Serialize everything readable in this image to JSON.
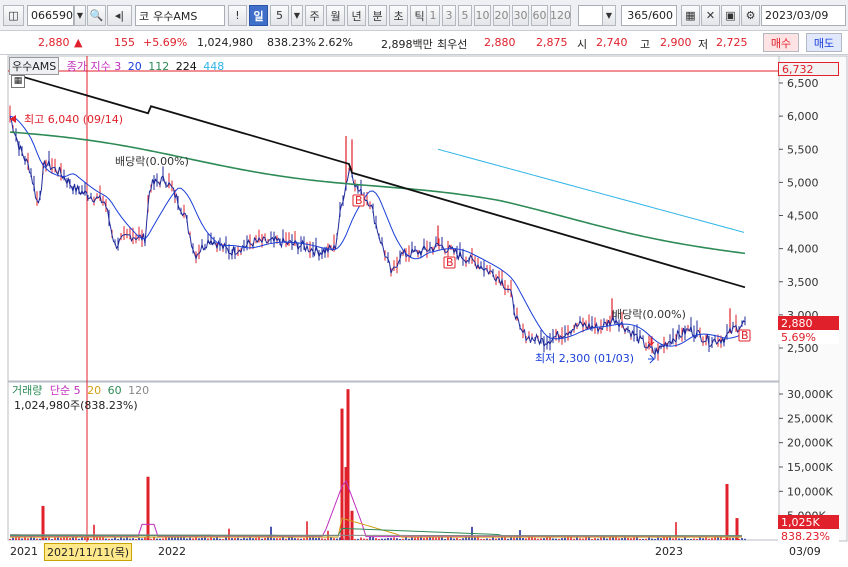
{
  "toolbar": {
    "stock_code": "066590",
    "market_code": "코",
    "stock_name": "우수AMS",
    "period_tabs": [
      {
        "label": "!",
        "active": false
      },
      {
        "label": "일",
        "active": true
      },
      {
        "label": "5",
        "active": false
      },
      {
        "label": "주",
        "active": false
      },
      {
        "label": "월",
        "active": false
      },
      {
        "label": "년",
        "active": false
      },
      {
        "label": "분",
        "active": false
      },
      {
        "label": "초",
        "active": false
      },
      {
        "label": "틱",
        "active": false
      }
    ],
    "minute_options": [
      "1",
      "3",
      "5",
      "10",
      "20",
      "30",
      "60",
      "120"
    ],
    "count_value": "365",
    "count_total": "/600",
    "date_value": "2023/03/09"
  },
  "quote": {
    "price": "2,880",
    "change_arrow": "▲",
    "change": "155",
    "change_pct": "+5.69%",
    "volume": "1,024,980",
    "volume_ratio": "838.23%",
    "turnover": "2.62%",
    "amount": "2,898백만",
    "priority_label": "최우선",
    "priority_ask": "2,880",
    "priority_bid": "2,875",
    "open_label": "시",
    "open": "2,740",
    "high_label": "고",
    "high": "2,900",
    "low_label": "저",
    "low": "2,725",
    "buy_label": "매수",
    "sell_label": "매도"
  },
  "price_panel": {
    "stock_name": "우수AMS",
    "ma_title": "종가 지수 3",
    "ma_periods": [
      "20",
      "112",
      "224",
      "448"
    ],
    "y_ticks": [
      "6,500",
      "6,000",
      "5,500",
      "5,000",
      "4,500",
      "4,000",
      "3,500",
      "3,000",
      "2,500"
    ],
    "high_tag": "6,732",
    "price_tag": "2,880",
    "pct_tag": "5.69%",
    "max_annotation": "최고 6,040 (09/14)",
    "min_annotation": "최저 2,300 (01/03)",
    "dividend_labels": [
      "배당락(0.00%)",
      "배당락(0.00%)"
    ],
    "marker_letter": "B",
    "colors": {
      "price_line": "#1f2a9a",
      "up_candle": "#e0202a",
      "ma20": "#1a3fd8",
      "ma112": "#2e8b57",
      "ma224": "#111111",
      "ma448": "#2fb4e8"
    }
  },
  "volume_panel": {
    "title": "거래량",
    "ma_label": "단순",
    "ma_periods": [
      "5",
      "20",
      "60",
      "120"
    ],
    "value_label": "1,024,980주(838.23%)",
    "y_ticks": [
      "30,000K",
      "25,000K",
      "20,000K",
      "15,000K",
      "10,000K",
      "5,000K"
    ],
    "vol_tag": "1,025K",
    "pct_tag": "838.23%"
  },
  "x_axis": {
    "labels": [
      "2021",
      "2022",
      "2023"
    ],
    "cursor_date": "2021/11/11(목)",
    "right_date": "03/09"
  }
}
